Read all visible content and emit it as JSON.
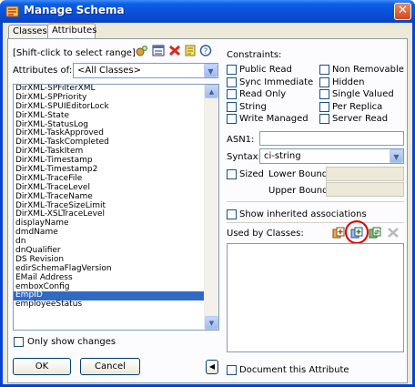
{
  "window": {
    "title": "Manage Schema",
    "close_glyph": "✕"
  },
  "tabs": [
    "Classes",
    "Attributes"
  ],
  "left": {
    "hint": "[Shift-click to select range]",
    "filter_label": "Attributes of:",
    "filter_value": "<All Classes>",
    "toolbar_icons": [
      "new-attribute-icon",
      "schema-icon",
      "delete-icon",
      "notes-icon",
      "help-icon"
    ],
    "attributes": [
      "DirXML-SPFilterXML",
      "DirXML-SPPriority",
      "DirXML-SPUIEditorLock",
      "DirXML-State",
      "DirXML-StatusLog",
      "DirXML-TaskApproved",
      "DirXML-TaskCompleted",
      "DirXML-TaskItem",
      "DirXML-Timestamp",
      "DirXML-Timestamp2",
      "DirXML-TraceFile",
      "DirXML-TraceLevel",
      "DirXML-TraceName",
      "DirXML-TraceSizeLimit",
      "DirXML-XSLTraceLevel",
      "displayName",
      "dmdName",
      "dn",
      "dnQualifier",
      "DS Revision",
      "edirSchemaFlagVersion",
      "EMail Address",
      "emboxConfig",
      "EmpID",
      "employeeStatus"
    ],
    "selected": "EmpID",
    "only_changes": "Only show changes",
    "ok": "OK",
    "cancel": "Cancel"
  },
  "right": {
    "constraints_label": "Constraints:",
    "constraints_left": [
      "Public Read",
      "Sync Immediate",
      "Read Only",
      "String",
      "Write Managed"
    ],
    "constraints_right": [
      "Non Removable",
      "Hidden",
      "Single Valued",
      "Per Replica",
      "Server Read"
    ],
    "asn1_label": "ASN1:",
    "asn1_value": "",
    "syntax_label": "Syntax:",
    "syntax_value": "ci-string",
    "sized": "Sized",
    "lower_bound": "Lower Bound:",
    "upper_bound": "Upper Bound:",
    "inherited": "Show inherited associations",
    "used_by": "Used by Classes:",
    "used_by_icons": [
      "add-class-icon",
      "add-class-highlighted-icon",
      "replace-class-icon",
      "remove-class-icon"
    ],
    "document": "Document this Attribute"
  },
  "colors": {
    "titlebar": "#0a4fd8",
    "selection": "#316ac5",
    "highlight_circle": "#e00000"
  }
}
